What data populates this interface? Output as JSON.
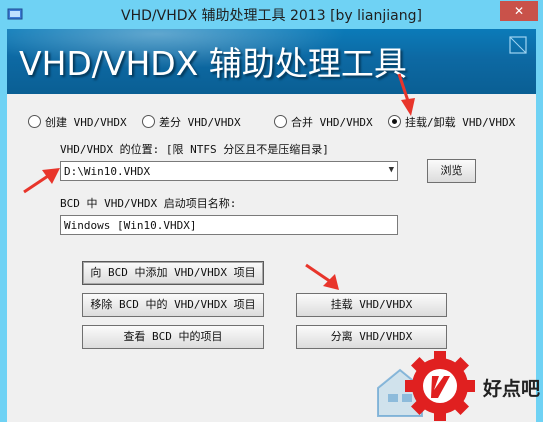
{
  "window": {
    "title": "VHD/VHDX 辅助处理工具 2013 [by lianjiang]",
    "close_label": "✕"
  },
  "banner": {
    "title": "VHD/VHDX 辅助处理工具"
  },
  "modes": [
    {
      "label": "创建 VHD/VHDX",
      "selected": false
    },
    {
      "label": "差分 VHD/VHDX",
      "selected": false
    },
    {
      "label": "合并 VHD/VHDX",
      "selected": false
    },
    {
      "label": "挂载/卸载 VHD/VHDX",
      "selected": true
    }
  ],
  "location": {
    "label": "VHD/VHDX 的位置: [限 NTFS 分区且不是压缩目录]",
    "value": "D:\\Win10.VHDX",
    "browse_label": "浏览"
  },
  "bcd": {
    "label": "BCD 中 VHD/VHDX 启动项目名称:",
    "value": "Windows [Win10.VHDX]"
  },
  "buttons": {
    "add_bcd": "向 BCD 中添加 VHD/VHDX 项目",
    "remove_bcd": "移除 BCD 中的 VHD/VHDX 项目",
    "view_bcd": "查看 BCD 中的项目",
    "mount": "挂载 VHD/VHDX",
    "detach": "分离 VHD/VHDX"
  },
  "watermark": {
    "text": "好点吧"
  },
  "colors": {
    "title_bar": "#6fd2f4",
    "banner": "#0b6ea8",
    "annotation_arrow": "#e8352b",
    "watermark_red": "#e02020"
  }
}
